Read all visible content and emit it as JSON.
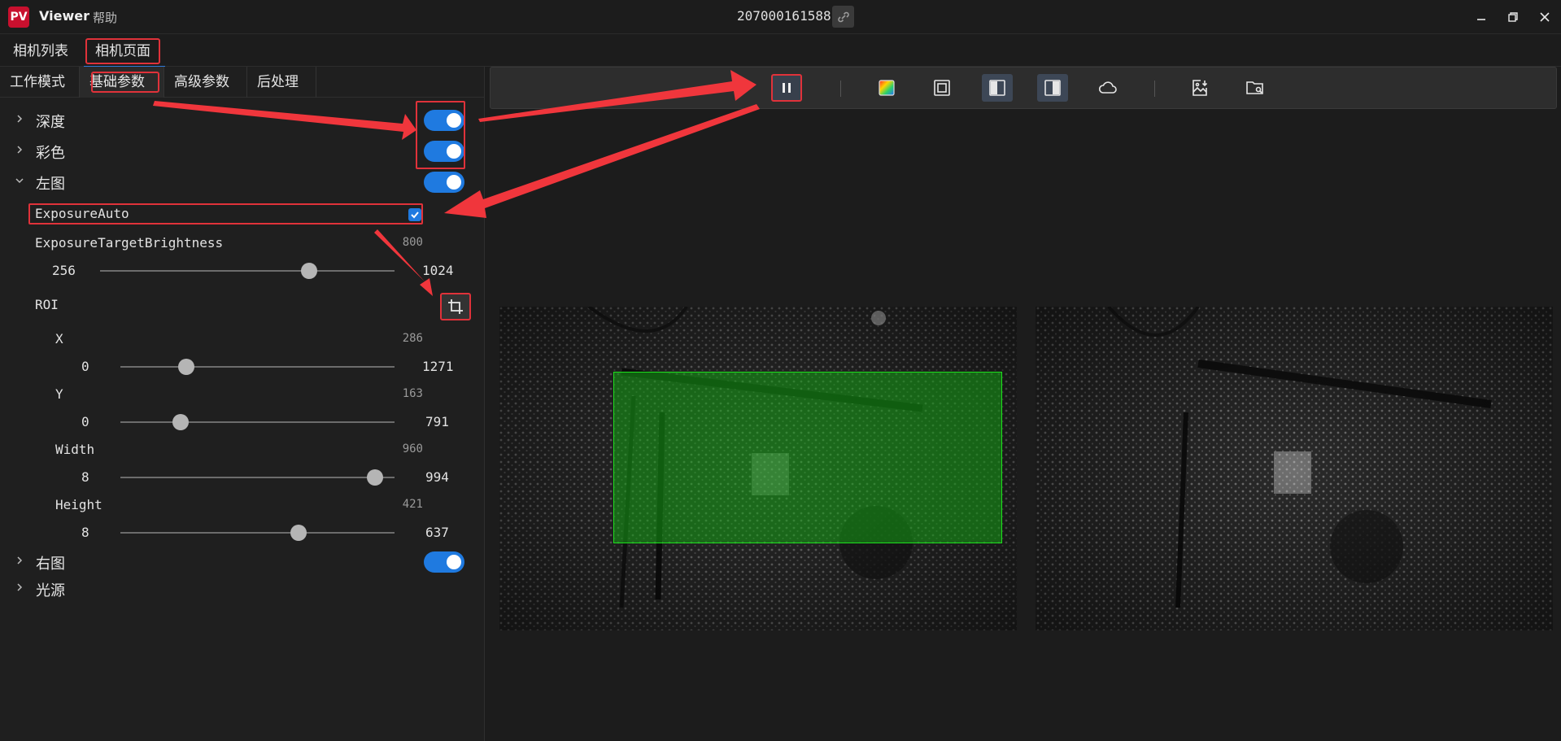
{
  "titlebar": {
    "logo_text": "PV",
    "app_title": "Viewer",
    "help_menu": "帮助",
    "serial": "207000161588",
    "link_icon": "link-broken-icon",
    "minimize_icon": "minimize-icon",
    "restore_icon": "restore-icon",
    "close_icon": "close-icon"
  },
  "main_tabs": [
    {
      "label": "相机列表",
      "active": false
    },
    {
      "label": "相机页面",
      "active": true
    }
  ],
  "sub_tabs": [
    {
      "label": "工作模式",
      "active": false
    },
    {
      "label": "基础参数",
      "active": true
    },
    {
      "label": "高级参数",
      "active": false
    },
    {
      "label": "后处理",
      "active": false
    }
  ],
  "sections": {
    "depth": {
      "label": "深度",
      "expanded": false,
      "enabled": true
    },
    "color": {
      "label": "彩色",
      "expanded": false,
      "enabled": true
    },
    "left": {
      "label": "左图",
      "expanded": true,
      "enabled": true
    },
    "right": {
      "label": "右图",
      "expanded": false,
      "enabled": true
    },
    "light": {
      "label": "光源",
      "expanded": false
    }
  },
  "left_params": {
    "exposure_auto": {
      "label": "ExposureAuto",
      "checked": true
    },
    "target_brightness": {
      "label": "ExposureTargetBrightness",
      "value": "800",
      "min": "256",
      "max": "1024",
      "fraction": 0.71
    },
    "roi": {
      "label": "ROI",
      "icon": "crop-icon"
    },
    "roi_x": {
      "label": "X",
      "value": "286",
      "min": "0",
      "max": "1271",
      "fraction": 0.24
    },
    "roi_y": {
      "label": "Y",
      "value": "163",
      "min": "0",
      "max": "791",
      "fraction": 0.22
    },
    "roi_width": {
      "label": "Width",
      "value": "960",
      "min": "8",
      "max": "994",
      "fraction": 0.93
    },
    "roi_height": {
      "label": "Height",
      "value": "421",
      "min": "8",
      "max": "637",
      "fraction": 0.65
    }
  },
  "toolbar": {
    "items": [
      "pause-icon",
      "color-map-icon",
      "frame-icon",
      "split-left-icon",
      "split-right-icon",
      "cloud-icon",
      "save-image-icon",
      "open-folder-icon"
    ]
  },
  "colors": {
    "accent": "#1f7ae0",
    "highlight": "#e0323a",
    "roi_overlay": "#19a019"
  }
}
